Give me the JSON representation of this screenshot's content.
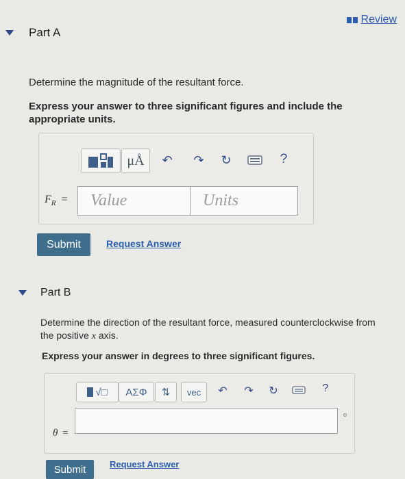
{
  "review": {
    "label": "Review"
  },
  "partA": {
    "title": "Part A",
    "question": "Determine the magnitude of the resultant force.",
    "instruction": "Express your answer to three significant figures and include the appropriate units.",
    "toolbar": {
      "units_symbol": "μÅ",
      "help": "?"
    },
    "variable_main": "F",
    "variable_sub": "R",
    "equals": "=",
    "value_placeholder": "Value",
    "units_placeholder": "Units",
    "submit_label": "Submit",
    "request_label": "Request Answer"
  },
  "partB": {
    "title": "Part B",
    "question": "Determine the direction of the resultant force, measured counterclockwise from the positive",
    "question_var": "x",
    "question_end": "axis.",
    "instruction": "Express your answer in degrees to three significant figures.",
    "toolbar": {
      "templates": "√□",
      "greek": "ΑΣΦ",
      "arrows": "⇅",
      "vec": "vec",
      "help": "?"
    },
    "variable": "θ",
    "equals": "=",
    "answer_value": "",
    "submit_label": "Submit",
    "request_label": "Request Answer"
  }
}
